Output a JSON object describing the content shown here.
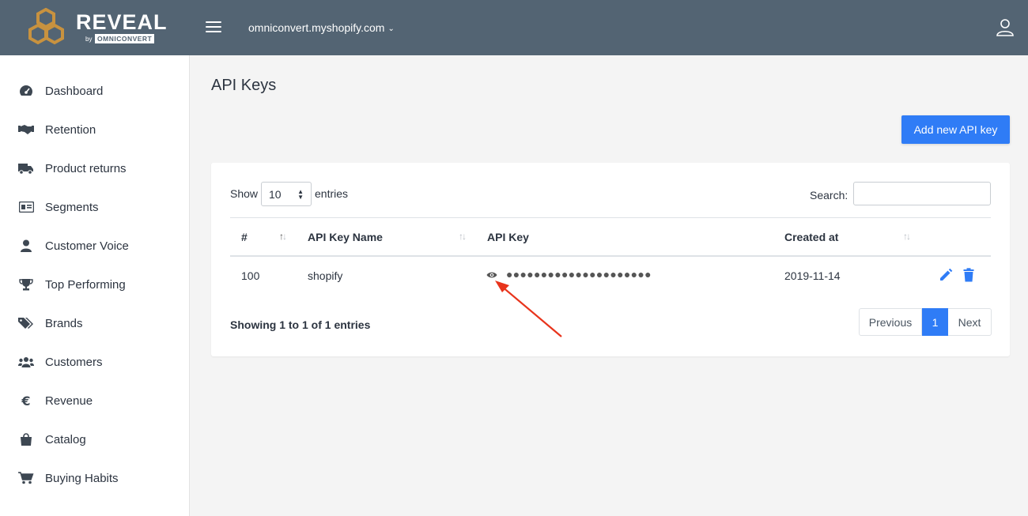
{
  "header": {
    "logo_text": "REVEAL",
    "logo_by": "by",
    "logo_brand": "OMNICONVERT",
    "store": "omniconvert.myshopify.com",
    "store_chevron": "⌄"
  },
  "sidebar": {
    "items": [
      {
        "label": "Dashboard",
        "icon": "gauge-icon"
      },
      {
        "label": "Retention",
        "icon": "handshake-icon"
      },
      {
        "label": "Product returns",
        "icon": "truck-icon"
      },
      {
        "label": "Segments",
        "icon": "id-card-icon"
      },
      {
        "label": "Customer Voice",
        "icon": "user-icon"
      },
      {
        "label": "Top Performing",
        "icon": "trophy-icon"
      },
      {
        "label": "Brands",
        "icon": "tags-icon"
      },
      {
        "label": "Customers",
        "icon": "users-icon"
      },
      {
        "label": "Revenue",
        "icon": "euro-icon"
      },
      {
        "label": "Catalog",
        "icon": "shopping-bag-icon"
      },
      {
        "label": "Buying Habits",
        "icon": "cart-icon"
      }
    ]
  },
  "main": {
    "title": "API Keys",
    "add_button": "Add new API key",
    "table": {
      "show_label": "Show",
      "page_size": "10",
      "entries_label": "entries",
      "search_label": "Search:",
      "search_value": "",
      "columns": [
        "#",
        "API Key Name",
        "API Key",
        "Created at"
      ],
      "rows": [
        {
          "id": "100",
          "name": "shopify",
          "key": "●●●●●●●●●●●●●●●●●●●●●",
          "created": "2019-11-14"
        }
      ],
      "info": "Showing 1 to 1 of 1 entries",
      "pagination": {
        "previous": "Previous",
        "current": "1",
        "next": "Next"
      }
    }
  },
  "colors": {
    "header_bg": "#536473",
    "accent": "#2f7cf6",
    "annotation_arrow": "#e8341c",
    "logo_gold": "#c8923f"
  }
}
